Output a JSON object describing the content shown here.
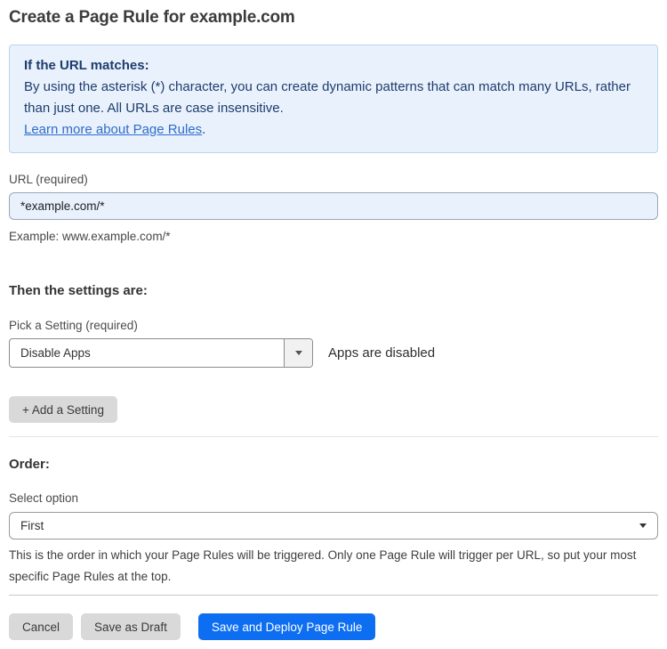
{
  "page": {
    "title": "Create a Page Rule for example.com"
  },
  "info_box": {
    "heading": "If the URL matches:",
    "body": "By using the asterisk (*) character, you can create dynamic patterns that can match many URLs, rather than just one. All URLs are case insensitive.",
    "link_text": "Learn more about Page Rules",
    "link_suffix": "."
  },
  "url_field": {
    "label": "URL (required)",
    "value": "*example.com/*",
    "helper": "Example: www.example.com/*"
  },
  "settings_section": {
    "heading": "Then the settings are:",
    "picker_label": "Pick a Setting (required)",
    "selected_setting": "Disable Apps",
    "setting_status": "Apps are disabled",
    "add_setting_label": "+ Add a Setting"
  },
  "order_section": {
    "heading": "Order:",
    "select_label": "Select option",
    "selected_option": "First",
    "helper": "This is the order in which your Page Rules will be triggered. Only one Page Rule will trigger per URL, so put your most specific Page Rules at the top."
  },
  "actions": {
    "cancel": "Cancel",
    "save_draft": "Save as Draft",
    "save_deploy": "Save and Deploy Page Rule"
  },
  "colors": {
    "accent_blue": "#0d6ef2",
    "info_bg": "#e9f2fc",
    "info_border": "#b8d5f0",
    "info_text": "#1d3c6e",
    "link_blue": "#2f6bcb",
    "input_bg": "#e9f1fd",
    "gray_btn": "#d9d9d9"
  }
}
